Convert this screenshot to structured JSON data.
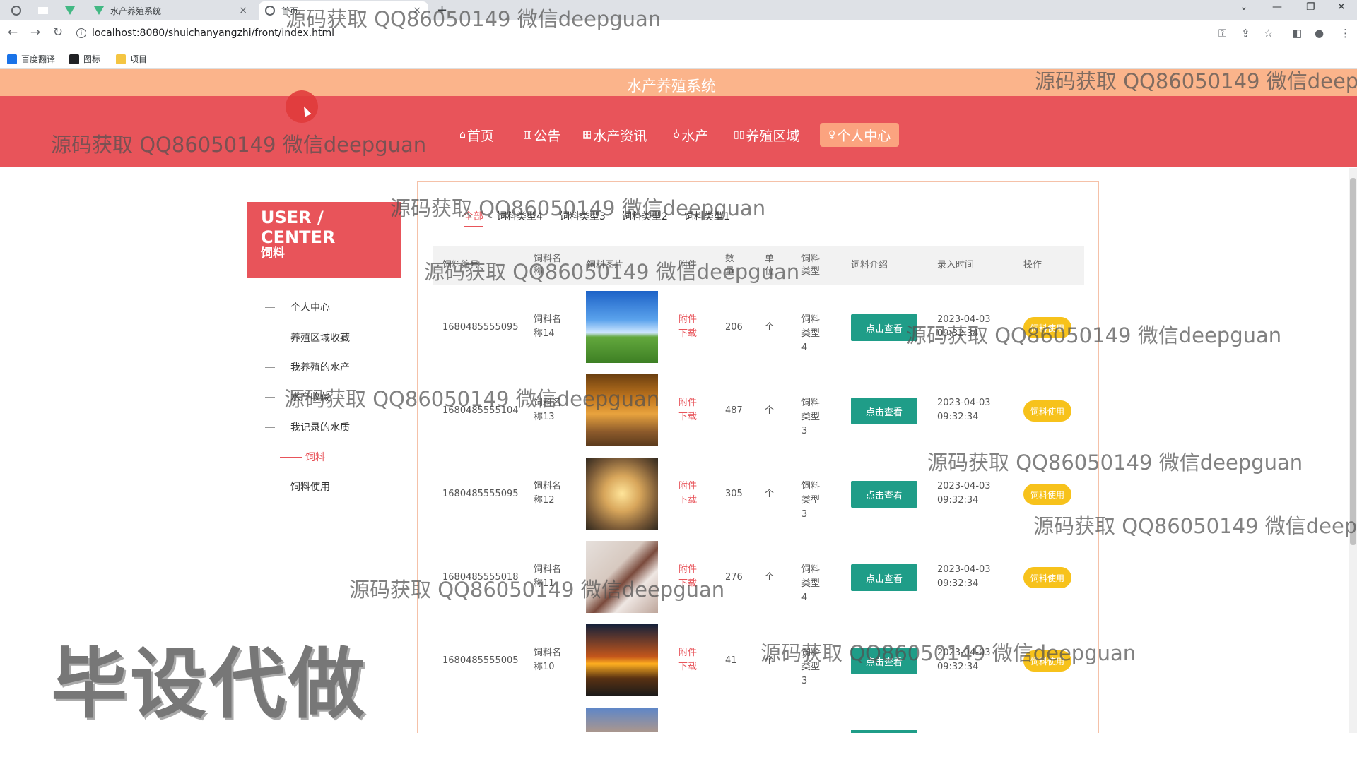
{
  "browser": {
    "tabs": [
      {
        "label": "",
        "icon": "globe-icon"
      },
      {
        "label": "",
        "icon": "blank-icon"
      },
      {
        "label": "",
        "icon": "vue-icon"
      },
      {
        "label": "水产养殖系统",
        "icon": "vue-icon"
      },
      {
        "label": "首页",
        "icon": "globe-icon"
      }
    ],
    "url": "localhost:8080/shuichanyangzhi/front/index.html",
    "bookmarks": [
      {
        "label": "百度翻译",
        "color": "#1a73e8"
      },
      {
        "label": "图标",
        "color": "#202124"
      },
      {
        "label": "项目",
        "color": "#f4c542"
      }
    ]
  },
  "site": {
    "title": "水产养殖系统",
    "nav": [
      {
        "label": "首页",
        "icon": "home-icon",
        "glyph": "⌂"
      },
      {
        "label": "公告",
        "icon": "notice-icon",
        "glyph": "▥"
      },
      {
        "label": "水产资讯",
        "icon": "news-icon",
        "glyph": "▦"
      },
      {
        "label": "水产",
        "icon": "fish-icon",
        "glyph": "♁"
      },
      {
        "label": "养殖区域",
        "icon": "area-icon",
        "glyph": "▯▯"
      },
      {
        "label": "个人中心",
        "icon": "user-icon",
        "glyph": "♀"
      }
    ]
  },
  "user_center": {
    "title": "USER / CENTER",
    "subtitle": "饲料",
    "menu": [
      "个人中心",
      "养殖区域收藏",
      "我养殖的水产",
      "水产收藏",
      "我记录的水质",
      "饲料",
      "饲料使用"
    ]
  },
  "filter_tabs": [
    "全部",
    "饲料类型4",
    "饲料类型3",
    "饲料类型2",
    "饲料类型1"
  ],
  "table": {
    "headers": [
      "饲料编号",
      "饲料名称",
      "饲料图片",
      "附件",
      "数量",
      "单位",
      "饲料类型",
      "饲料介绍",
      "录入时间",
      "操作"
    ],
    "rows": [
      {
        "id": "1680485555095",
        "name": "饲料名称14",
        "qty": "206",
        "unit": "个",
        "type": "饲料类型4",
        "date": "2023-04-03",
        "time": "09:32:34"
      },
      {
        "id": "1680485555104",
        "name": "饲料名称13",
        "qty": "487",
        "unit": "个",
        "type": "饲料类型3",
        "date": "2023-04-03",
        "time": "09:32:34"
      },
      {
        "id": "1680485555095",
        "name": "饲料名称12",
        "qty": "305",
        "unit": "个",
        "type": "饲料类型3",
        "date": "2023-04-03",
        "time": "09:32:34"
      },
      {
        "id": "1680485555018",
        "name": "饲料名称11",
        "qty": "276",
        "unit": "个",
        "type": "饲料类型4",
        "date": "2023-04-03",
        "time": "09:32:34"
      },
      {
        "id": "1680485555005",
        "name": "饲料名称10",
        "qty": "41",
        "unit": "个",
        "type": "饲料类型3",
        "date": "2023-04-03",
        "time": "09:32:34"
      }
    ],
    "attach_label_1": "附件",
    "attach_label_2": "下载",
    "view_label": "点击查看",
    "use_label": "饲料使用"
  },
  "watermark": {
    "text": "源码获取 QQ86050149 微信deepguan",
    "big": "毕设代做"
  }
}
